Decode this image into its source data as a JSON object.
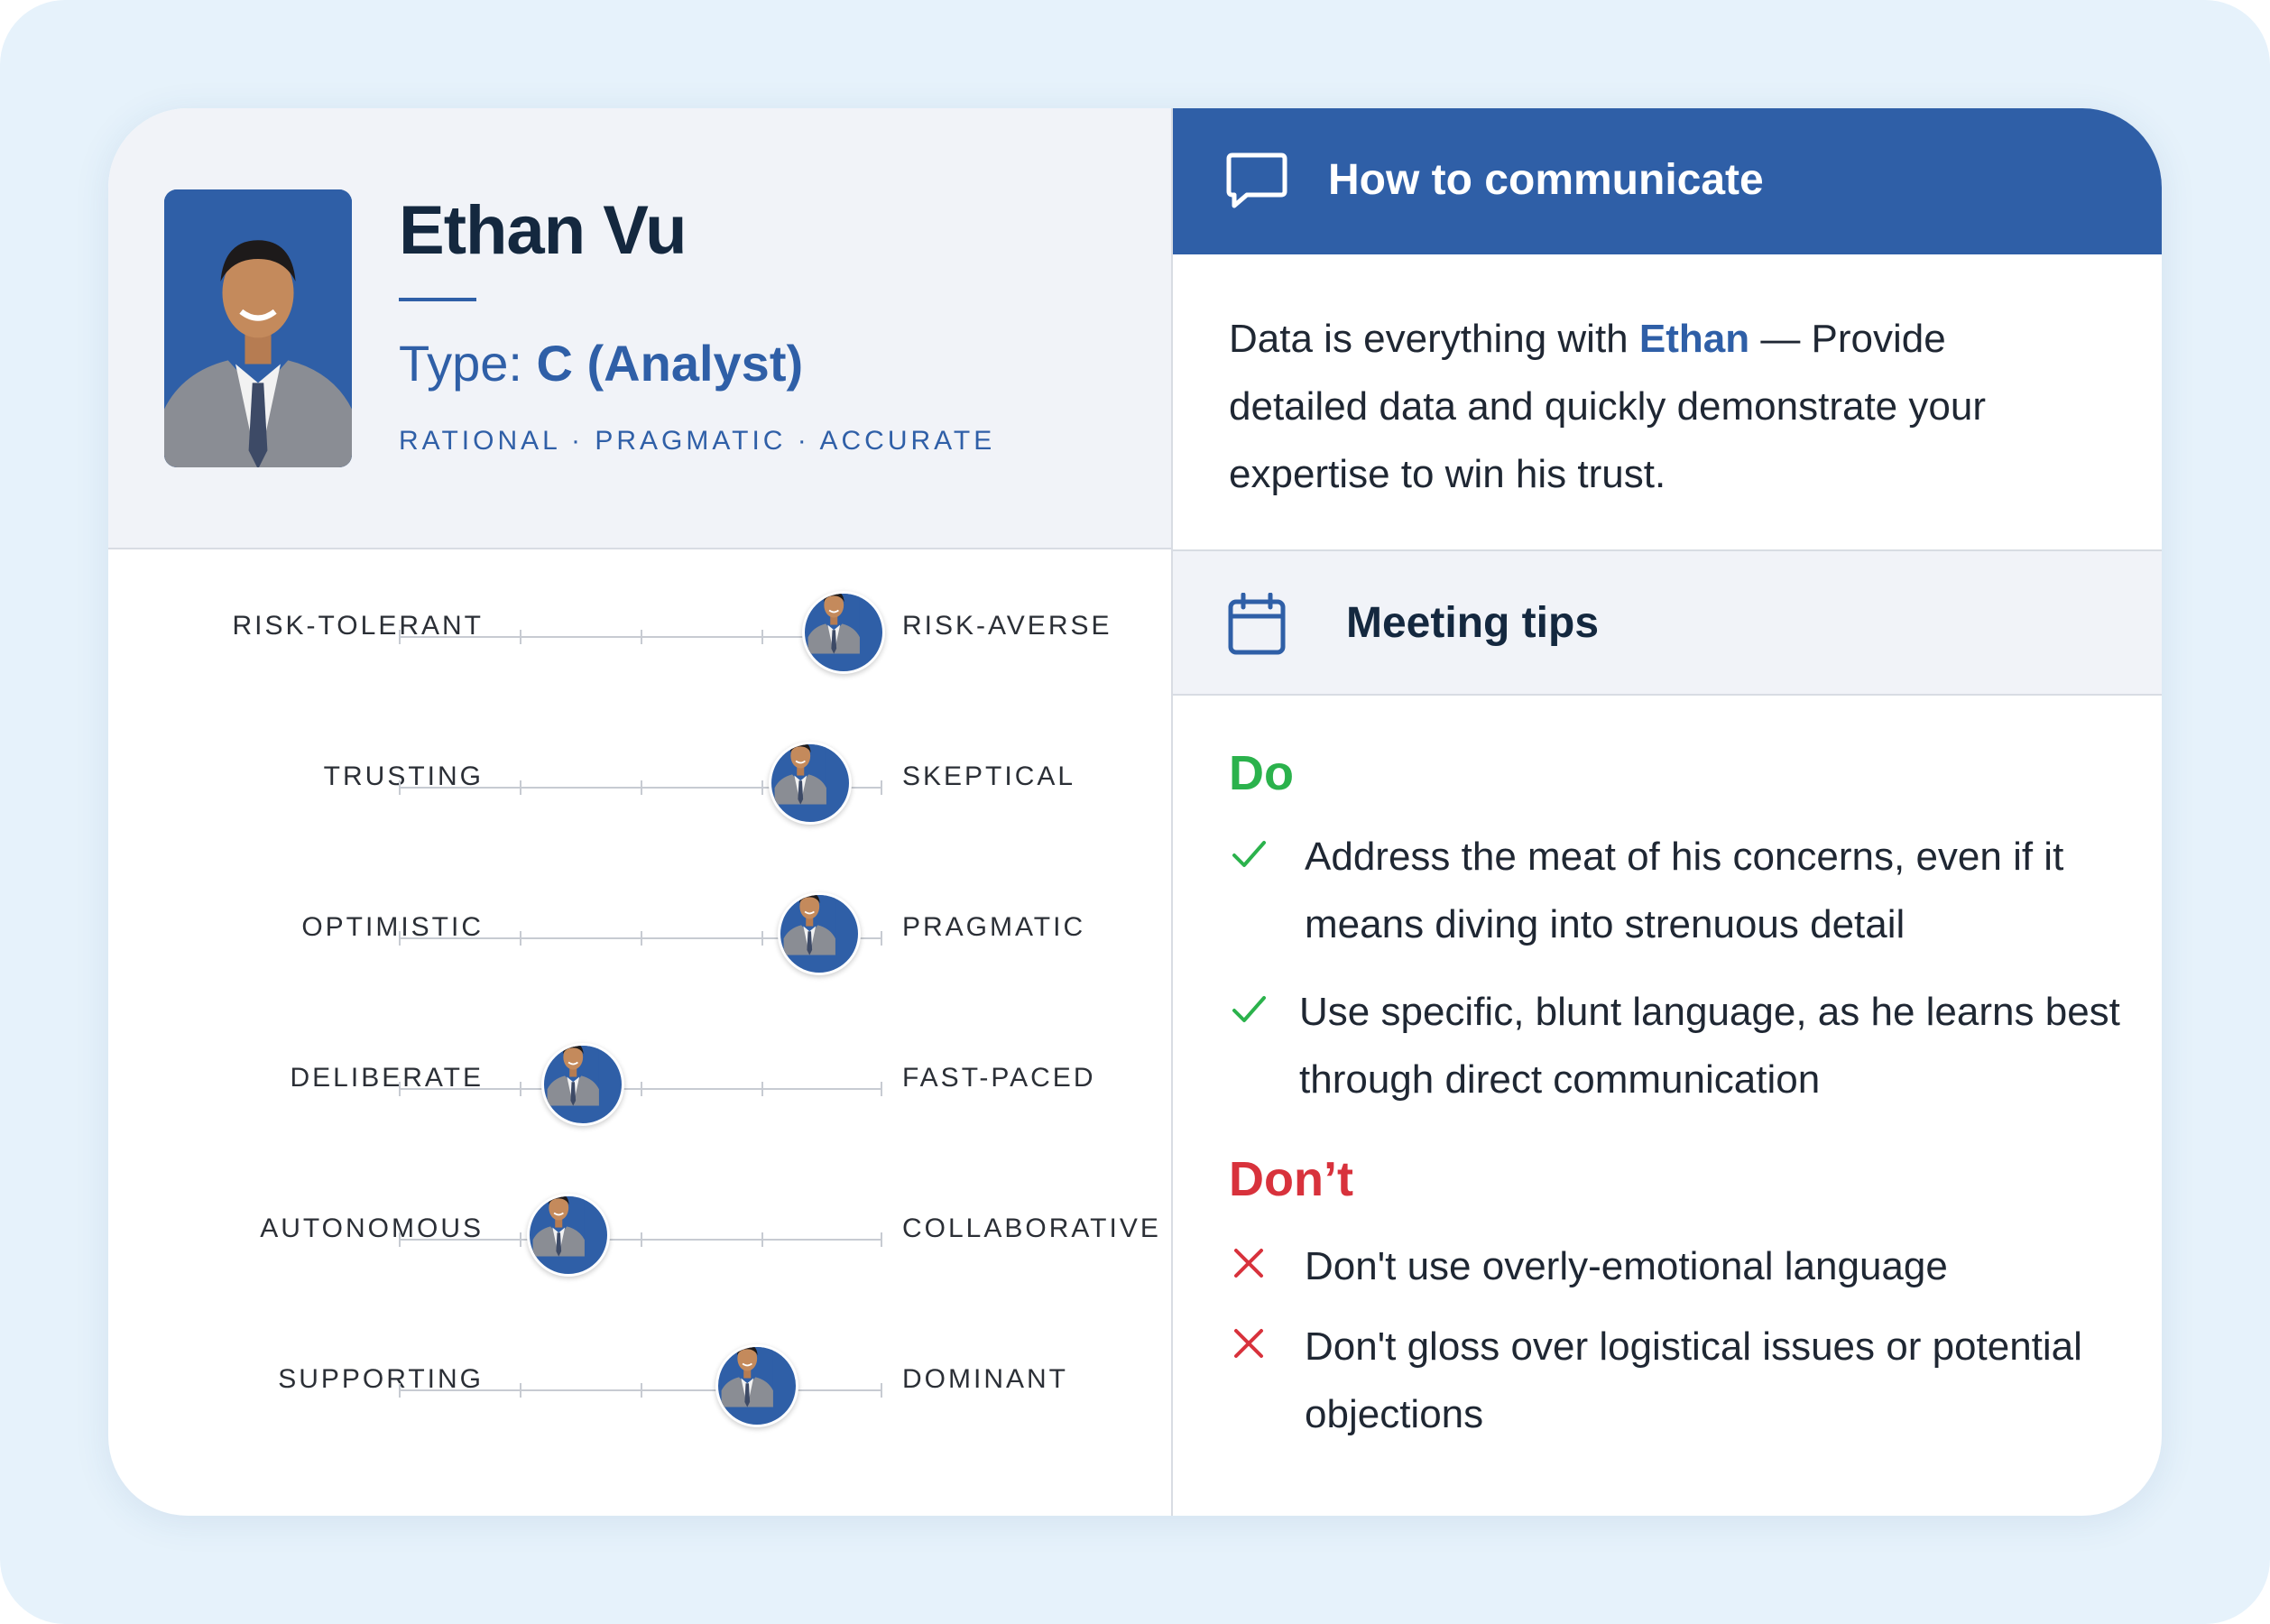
{
  "profile": {
    "name": "Ethan Vu",
    "type_prefix": "Type: ",
    "type_value": "C (Analyst)",
    "traits": "RATIONAL · PRAGMATIC · ACCURATE"
  },
  "sliders": [
    {
      "left": "RISK-TOLERANT",
      "right": "RISK-AVERSE",
      "position": 0.92
    },
    {
      "left": "TRUSTING",
      "right": "SKEPTICAL",
      "position": 0.85
    },
    {
      "left": "OPTIMISTIC",
      "right": "PRAGMATIC",
      "position": 0.87
    },
    {
      "left": "DELIBERATE",
      "right": "FAST-PACED",
      "position": 0.38
    },
    {
      "left": "AUTONOMOUS",
      "right": "COLLABORATIVE",
      "position": 0.35
    },
    {
      "left": "SUPPORTING",
      "right": "DOMINANT",
      "position": 0.74
    }
  ],
  "communicate": {
    "title": "How to communicate",
    "text_before": "Data is everything with ",
    "highlight": "Ethan",
    "text_after": " — Provide detailed data and quickly demonstrate your expertise to win his trust."
  },
  "tips": {
    "title": "Meeting tips",
    "do_title": "Do",
    "do_items": [
      "Address the meat of his concerns, even if it means diving into strenuous detail",
      "Use specific, blunt language, as he learns best through direct communication"
    ],
    "dont_title": "Don’t",
    "dont_items": [
      "Don't use overly-emotional language",
      "Don't gloss over logistical issues or potential objections"
    ]
  },
  "icons": {
    "communicate": "chat-bubble-icon",
    "tips": "calendar-icon",
    "do": "check-icon",
    "dont": "cross-icon"
  },
  "colors": {
    "brand_blue": "#2f5fa7",
    "do_green": "#2bb24c",
    "dont_red": "#d8323c",
    "panel_gray": "#f1f3f8",
    "background": "#e6f2fb"
  }
}
